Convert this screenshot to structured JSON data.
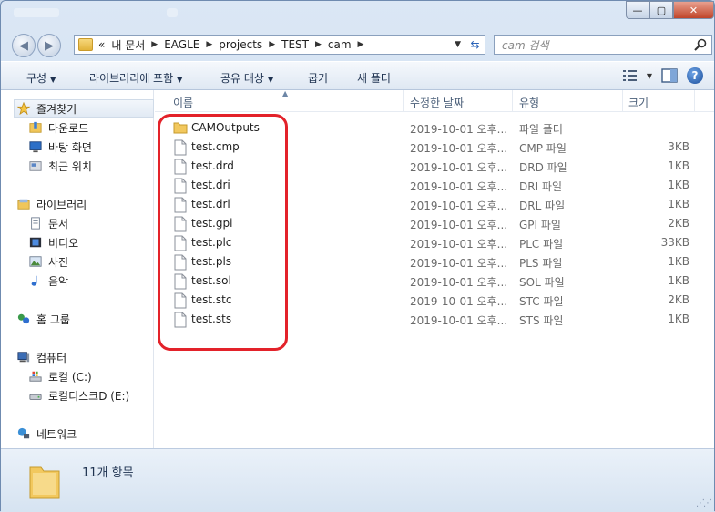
{
  "window": {
    "close_label": "✕",
    "max_label": "▢",
    "min_label": "—"
  },
  "address_bar": {
    "overflow": "«",
    "crumbs": [
      "내 문서",
      "EAGLE",
      "projects",
      "TEST",
      "cam"
    ],
    "search_placeholder": "cam 검색"
  },
  "toolbar": {
    "organize": "구성",
    "include_library": "라이브러리에 포함",
    "share": "공유 대상",
    "burn": "굽기",
    "new_folder": "새 폴더"
  },
  "nav": {
    "favorites": "즐겨찾기",
    "downloads": "다운로드",
    "desktop": "바탕 화면",
    "recent": "최근 위치",
    "libraries": "라이브러리",
    "documents": "문서",
    "videos": "비디오",
    "pictures": "사진",
    "music": "음악",
    "homegroup": "홈 그룹",
    "computer": "컴퓨터",
    "local_c": "로컬 (C:)",
    "local_e": "로컬디스크D (E:)",
    "network": "네트워크"
  },
  "columns": {
    "name": "이름",
    "date": "수정한 날짜",
    "type": "유형",
    "size": "크기"
  },
  "files": [
    {
      "name": "CAMOutputs",
      "date": "2019-10-01 오후...",
      "type": "파일 폴더",
      "size": "",
      "icon": "folder-icon"
    },
    {
      "name": "test.cmp",
      "date": "2019-10-01 오후...",
      "type": "CMP 파일",
      "size": "3KB",
      "icon": "file-icon"
    },
    {
      "name": "test.drd",
      "date": "2019-10-01 오후...",
      "type": "DRD 파일",
      "size": "1KB",
      "icon": "file-icon"
    },
    {
      "name": "test.dri",
      "date": "2019-10-01 오후...",
      "type": "DRI 파일",
      "size": "1KB",
      "icon": "file-icon"
    },
    {
      "name": "test.drl",
      "date": "2019-10-01 오후...",
      "type": "DRL 파일",
      "size": "1KB",
      "icon": "file-icon"
    },
    {
      "name": "test.gpi",
      "date": "2019-10-01 오후...",
      "type": "GPI 파일",
      "size": "2KB",
      "icon": "file-icon"
    },
    {
      "name": "test.plc",
      "date": "2019-10-01 오후...",
      "type": "PLC 파일",
      "size": "33KB",
      "icon": "file-icon"
    },
    {
      "name": "test.pls",
      "date": "2019-10-01 오후...",
      "type": "PLS 파일",
      "size": "1KB",
      "icon": "file-icon"
    },
    {
      "name": "test.sol",
      "date": "2019-10-01 오후...",
      "type": "SOL 파일",
      "size": "1KB",
      "icon": "file-icon"
    },
    {
      "name": "test.stc",
      "date": "2019-10-01 오후...",
      "type": "STC 파일",
      "size": "2KB",
      "icon": "file-icon"
    },
    {
      "name": "test.sts",
      "date": "2019-10-01 오후...",
      "type": "STS 파일",
      "size": "1KB",
      "icon": "file-icon"
    }
  ],
  "status": {
    "item_count": "11개 항목"
  },
  "colors": {
    "highlight": "#e3222a",
    "accent": "#1e3250"
  }
}
